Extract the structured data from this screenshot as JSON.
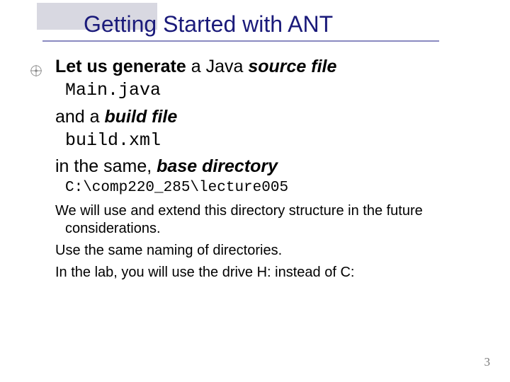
{
  "title": "Getting Started with ANT",
  "line1": {
    "part1": "Let us generate",
    "part2": " a Java ",
    "part3": "source file"
  },
  "code1": "Main.java",
  "line2": {
    "part1": "and a ",
    "part2": "build file"
  },
  "code2": "build.xml",
  "line3": {
    "part1": "in the same, ",
    "part2": "base directory"
  },
  "code3": "C:\\comp220_285\\lecture005",
  "body1": "We will use and extend this directory structure in the future considerations.",
  "body2": "Use the same naming of directories.",
  "body3": "In the lab, you will use the drive H: instead of  C:",
  "pagenum": "3"
}
